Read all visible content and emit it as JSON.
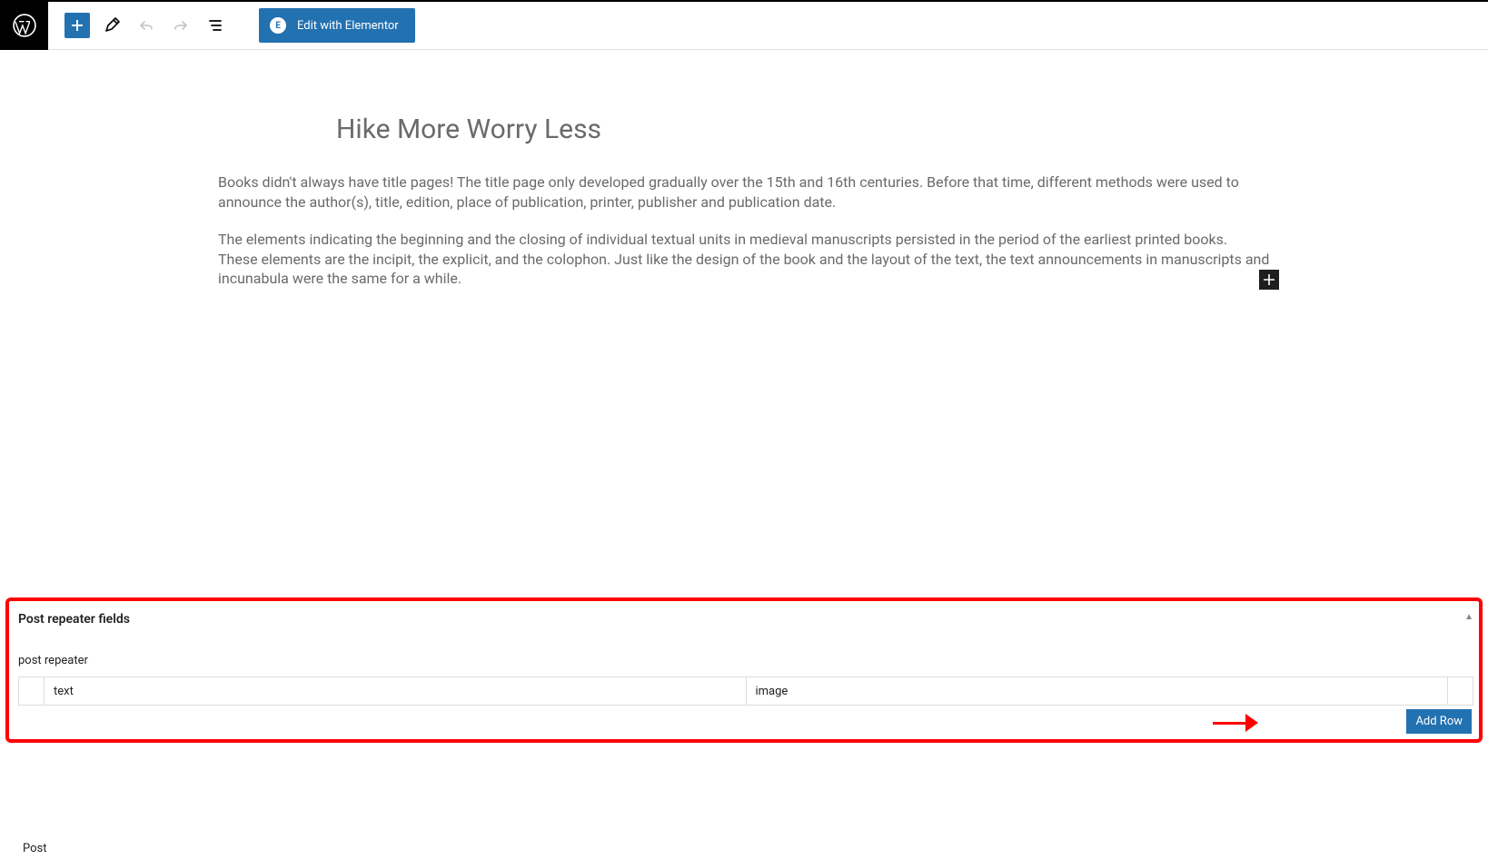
{
  "toolbar": {
    "elementor_label": "Edit with Elementor"
  },
  "post": {
    "title": "Hike More Worry Less",
    "paragraphs": {
      "0": "Books didn't always have title pages! The title page only developed gradually over the 15th and 16th centuries. Before that time, different methods were used to announce the author(s), title, edition, place of publication, printer, publisher and publication date.",
      "1": "The elements indicating the beginning and the closing of individual textual units in medieval manuscripts persisted in the period of the earliest printed books. These elements are the incipit, the explicit, and the colophon. Just like the design of the book and the layout of the text, the text announcements in manuscripts and incunabula were the same for a while."
    }
  },
  "repeater_panel": {
    "title": "Post repeater fields",
    "sub_label": "post repeater",
    "columns": {
      "text": "text",
      "image": "image"
    },
    "add_row_label": "Add Row"
  },
  "footer": {
    "breadcrumb": "Post"
  },
  "icons": {
    "elementor_badge": "E"
  }
}
